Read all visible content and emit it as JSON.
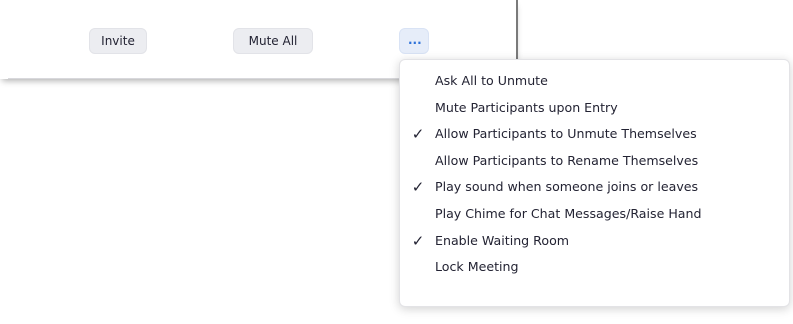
{
  "toolbar": {
    "invite_label": "Invite",
    "mute_all_label": "Mute All",
    "more_label": "..."
  },
  "menu": {
    "check_glyph": "✓",
    "items": [
      {
        "label": "Ask All to Unmute",
        "checked": false
      },
      {
        "label": "Mute Participants upon Entry",
        "checked": false
      },
      {
        "label": "Allow Participants to Unmute Themselves",
        "checked": true
      },
      {
        "label": "Allow Participants to Rename Themselves",
        "checked": false
      },
      {
        "label": "Play sound when someone joins or leaves",
        "checked": true
      },
      {
        "label": "Play Chime for Chat Messages/Raise Hand",
        "checked": false
      },
      {
        "label": "Enable Waiting Room",
        "checked": true
      },
      {
        "label": "Lock Meeting",
        "checked": false
      }
    ]
  },
  "colors": {
    "more_button_text": "#2d72d9",
    "button_bg": "#ecedf1",
    "text": "#232333"
  }
}
